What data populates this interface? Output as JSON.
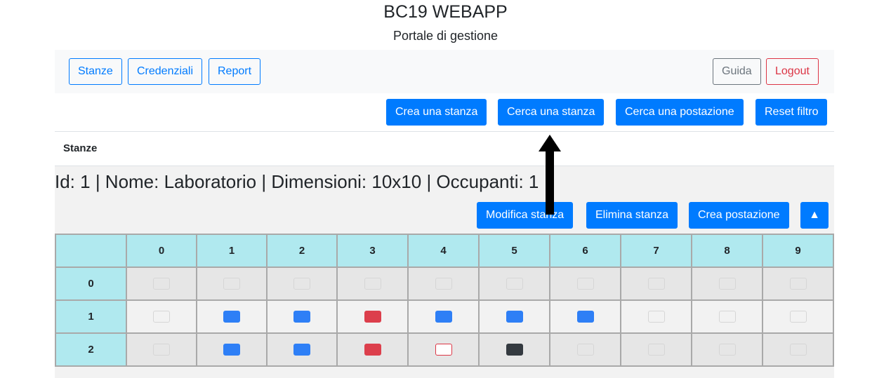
{
  "header": {
    "title": "BC19 WEBAPP",
    "subtitle": "Portale di gestione"
  },
  "navbar": {
    "stanze": "Stanze",
    "credenziali": "Credenziali",
    "report": "Report",
    "guida": "Guida",
    "logout": "Logout"
  },
  "toolbar": {
    "crea_stanza": "Crea una stanza",
    "cerca_stanza": "Cerca una stanza",
    "cerca_postazione": "Cerca una postazione",
    "reset_filtro": "Reset filtro"
  },
  "section": {
    "label": "Stanze"
  },
  "room": {
    "heading": "Id: 1 | Nome: Laboratorio | Dimensioni: 10x10 | Occupanti: 1",
    "modifica": "Modifica stanza",
    "elimina": "Elimina stanza",
    "crea_postazione": "Crea postazione",
    "collapse": "▲",
    "columns": [
      "0",
      "1",
      "2",
      "3",
      "4",
      "5",
      "6",
      "7",
      "8",
      "9"
    ],
    "rows": [
      {
        "label": "0",
        "seats": [
          "empty",
          "empty",
          "empty",
          "empty",
          "empty",
          "empty",
          "empty",
          "empty",
          "empty",
          "empty"
        ]
      },
      {
        "label": "1",
        "seats": [
          "empty",
          "blue",
          "blue",
          "red",
          "blue",
          "blue",
          "blue",
          "empty",
          "empty",
          "empty"
        ]
      },
      {
        "label": "2",
        "seats": [
          "empty",
          "blue",
          "blue",
          "red",
          "outline-red",
          "dark",
          "empty",
          "empty",
          "empty",
          "empty"
        ]
      }
    ]
  },
  "colors": {
    "primary": "#007bff",
    "header_cell": "#b0e9ef",
    "seat_blue": "#2e7ff6",
    "seat_red": "#dc3f4c",
    "seat_dark": "#343a40"
  }
}
